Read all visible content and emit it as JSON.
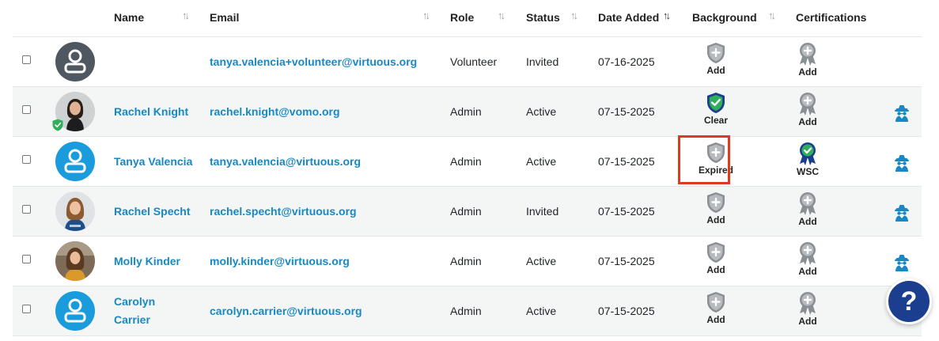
{
  "headers": {
    "name": "Name",
    "email": "Email",
    "role": "Role",
    "status": "Status",
    "date_added": "Date Added",
    "background": "Background",
    "certifications": "Certifications"
  },
  "sort_glyph": "↑↓",
  "rows": [
    {
      "name_line1": "",
      "name_line2": "",
      "email": "tanya.valencia+volunteer@virtuous.org",
      "role": "Volunteer",
      "status": "Invited",
      "date_added": "07-16-2025",
      "background": "Add",
      "certification": "Add",
      "avatar": "placeholder-gray"
    },
    {
      "name_line1": "Rachel Knight",
      "name_line2": "",
      "email": "rachel.knight@vomo.org",
      "role": "Admin",
      "status": "Active",
      "date_added": "07-15-2025",
      "background": "Clear",
      "certification": "Add",
      "avatar": "photo"
    },
    {
      "name_line1": "Tanya Valencia",
      "name_line2": "",
      "email": "tanya.valencia@virtuous.org",
      "role": "Admin",
      "status": "Active",
      "date_added": "07-15-2025",
      "background": "Expired",
      "certification": "WSC",
      "avatar": "placeholder-blue"
    },
    {
      "name_line1": "Rachel Specht",
      "name_line2": "",
      "email": "rachel.specht@virtuous.org",
      "role": "Admin",
      "status": "Invited",
      "date_added": "07-15-2025",
      "background": "Add",
      "certification": "Add",
      "avatar": "photo"
    },
    {
      "name_line1": "Molly Kinder",
      "name_line2": "",
      "email": "molly.kinder@virtuous.org",
      "role": "Admin",
      "status": "Active",
      "date_added": "07-15-2025",
      "background": "Add",
      "certification": "Add",
      "avatar": "photo"
    },
    {
      "name_line1": "Carolyn",
      "name_line2": "Carrier",
      "email": "carolyn.carrier@virtuous.org",
      "role": "Admin",
      "status": "Active",
      "date_added": "07-15-2025",
      "background": "Add",
      "certification": "Add",
      "avatar": "placeholder-blue"
    }
  ],
  "help": {
    "label": "?"
  },
  "colors": {
    "link": "#1788c3",
    "shield_gray": "#8a8f94",
    "shield_clear": "#2fae5b",
    "shield_navy": "#1b3e8e",
    "highlight": "#e03a1e",
    "avatar_blue": "#1a9bdc",
    "avatar_gray": "#4f5861",
    "help_bg": "#1b3e8e"
  }
}
